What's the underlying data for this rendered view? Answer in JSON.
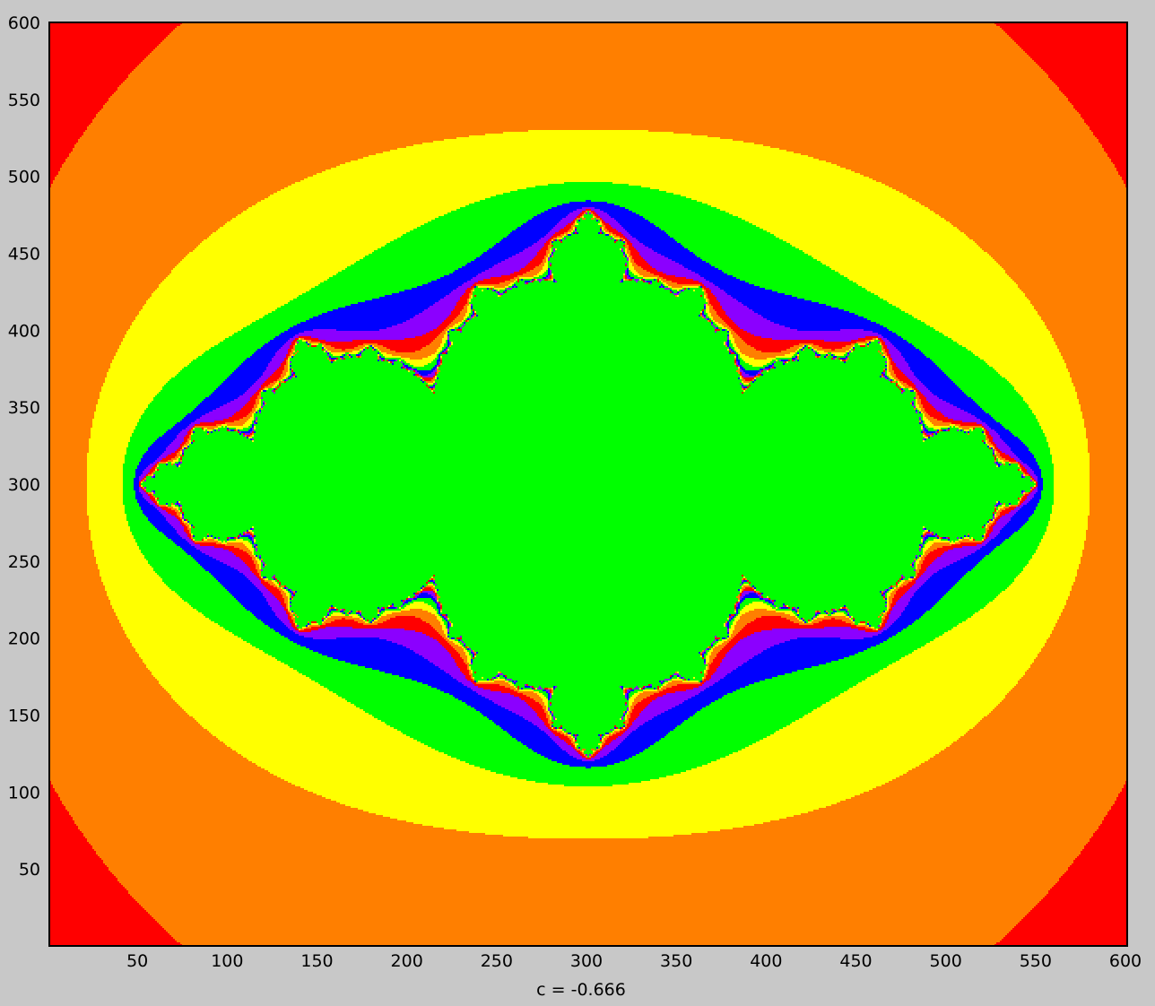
{
  "chart_data": {
    "type": "heatmap",
    "subtype": "julia-set escape-time",
    "xlabel": "c = -0.666",
    "c": -0.666,
    "xlim": [
      0,
      600
    ],
    "ylim": [
      0,
      600
    ],
    "x_ticks": [
      "50",
      "100",
      "150",
      "200",
      "250",
      "300",
      "350",
      "400",
      "450",
      "500",
      "550",
      "600"
    ],
    "y_ticks": [
      "600",
      "550",
      "500",
      "450",
      "400",
      "350",
      "300",
      "250",
      "200",
      "150",
      "100",
      "50"
    ],
    "grid": false,
    "legend": "none",
    "palette": [
      "#ff0000",
      "#ff7f00",
      "#ffff00",
      "#00ff00",
      "#0000ff",
      "#8b00ff"
    ],
    "background_color": "#ff0000",
    "frame_color": "#000000"
  }
}
